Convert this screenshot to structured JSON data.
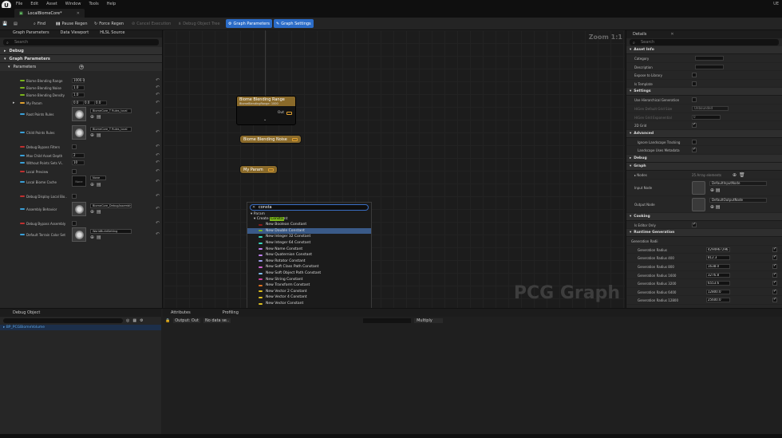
{
  "menu": {
    "items": [
      "File",
      "Edit",
      "Asset",
      "Window",
      "Tools",
      "Help"
    ],
    "right": "UE"
  },
  "tab": {
    "title": "LocalBiomeCore*"
  },
  "toolbar": {
    "find": "Find",
    "pause_regen": "Pause Regen",
    "force_regen": "Force Regen",
    "cancel_execution": "Cancel Execution",
    "debug_object_tree": "Debug Object Tree",
    "graph_parameters": "Graph Parameters",
    "graph_settings": "Graph Settings"
  },
  "left_panel": {
    "tabs": [
      "Graph Parameters",
      "Data Viewport",
      "HLSL Source"
    ],
    "search_placeholder": "Search",
    "sections": {
      "debug": "Debug",
      "graph_parameters": "Graph Parameters",
      "parameters": "Parameters"
    },
    "rows": [
      {
        "label": "Biome Blending Range",
        "value": "1000.0",
        "color": "#7ab51d"
      },
      {
        "label": "Biome Blending Noise",
        "value": "1.0",
        "color": "#7ab51d"
      },
      {
        "label": "Biome Blending Density",
        "value": "1.0",
        "color": "#7ab51d"
      },
      {
        "label": "My Param",
        "value": "0.0",
        "color": "#e0a030"
      },
      {
        "label": "Root Points Rules",
        "asset": "BiomeCore_T Rules_local",
        "color": "#3aa0d8"
      },
      {
        "label": "Child Points Rules",
        "asset": "BiomeCore_T Rules_local",
        "color": "#3aa0d8"
      },
      {
        "label": "Debug Bypass Filters",
        "color": "#c03030"
      },
      {
        "label": "Max Child Asset Depth",
        "value": "2",
        "color": "#3aa0d8"
      },
      {
        "label": "Without Points Sets Vi..",
        "value": "10",
        "color": "#3aa0d8"
      },
      {
        "label": "Local Preview",
        "color": "#c03030"
      },
      {
        "label": "Local Biome Cache",
        "asset": "None",
        "color": "#3aa0d8"
      },
      {
        "label": "Debug Display Local Bio..",
        "color": "#c03030"
      },
      {
        "label": "Assembly Behavior",
        "asset": "BiomeCore_DebugAssemblyBehavior",
        "color": "#3aa0d8"
      },
      {
        "label": "Debug Bypass Assembly",
        "color": "#c03030"
      },
      {
        "label": "Default Terrain Color Set",
        "asset": "WorldBuildSetting",
        "color": "#3aa0d8"
      }
    ]
  },
  "graph": {
    "zoom": "Zoom 1:1",
    "watermark": "PCG Graph",
    "node1": {
      "title": "Biome Blending Range",
      "subtitle": "BiomeBlendingRange: 1000",
      "out": "Out"
    },
    "node2": {
      "title": "Biome Blending Noise"
    },
    "node3": {
      "title": "My Param"
    }
  },
  "context_menu": {
    "search_value": "consta",
    "category": "Param",
    "subcategory_prefix": "Create ",
    "subcategory_highlight": "Consta",
    "subcategory_suffix": "nt",
    "items": [
      {
        "label": "New Boolean Constant",
        "color": "#8b1a1a"
      },
      {
        "label": "New Double Constant",
        "color": "#7ab51d"
      },
      {
        "label": "New Integer 32 Constant",
        "color": "#3ad8c0"
      },
      {
        "label": "New Integer 64 Constant",
        "color": "#3ad8c0"
      },
      {
        "label": "New Name Constant",
        "color": "#c080f0"
      },
      {
        "label": "New Quaternion Constant",
        "color": "#c080f0"
      },
      {
        "label": "New Rotator Constant",
        "color": "#a0a0f0"
      },
      {
        "label": "New Soft Class Path Constant",
        "color": "#d060d0"
      },
      {
        "label": "New Soft Object Path Constant",
        "color": "#80c0f0"
      },
      {
        "label": "New String Constant",
        "color": "#d040a0"
      },
      {
        "label": "New Transform Constant",
        "color": "#e07020"
      },
      {
        "label": "New Vector 2 Constant",
        "color": "#e0c020"
      },
      {
        "label": "New Vector 4 Constant",
        "color": "#e0c020"
      },
      {
        "label": "New Vector Constant",
        "color": "#e0c020"
      }
    ]
  },
  "details": {
    "tab": "Details",
    "search_placeholder": "Search",
    "sections": {
      "asset_info": "Asset Info",
      "settings": "Settings",
      "advanced": "Advanced",
      "debug": "Debug",
      "graph": "Graph",
      "cooking": "Cooking",
      "runtime_generation": "Runtime Generation"
    },
    "asset_info_rows": [
      "Category",
      "Description",
      "Expose to Library",
      "Is Template"
    ],
    "settings_rows": {
      "use_hierarchical": "Use Hierarchical Generation",
      "default_grid": "HiGen Default Grid Size",
      "default_grid_value": "Unbounded",
      "grid_exponential": "HiGen Grid Exponential",
      "grid_exponential_value": "0",
      "is_2d": "2D Grid"
    },
    "advanced_rows": [
      "Ignore Landscape Tracking",
      "Landscape Uses Metadata"
    ],
    "graph_rows": {
      "nodes": "Nodes",
      "nodes_value": "25 Array elements",
      "input_node": "Input Node",
      "input_node_value": "DefaultInputNode",
      "output_node": "Output Node",
      "output_node_value": "DefaultOutputNode"
    },
    "cooking_row": "Is Editor Only",
    "runtime_rows": [
      {
        "label": "Generation Radii",
        "value": ""
      },
      {
        "label": "Generation Radius",
        "value": "4294967296.0"
      },
      {
        "label": "Generation Radius 400",
        "value": "812.3"
      },
      {
        "label": "Generation Radius 800",
        "value": "1638.0"
      },
      {
        "label": "Generation Radius 1600",
        "value": "3276.8"
      },
      {
        "label": "Generation Radius 3200",
        "value": "6553.6"
      },
      {
        "label": "Generation Radius 6400",
        "value": "12800.0"
      },
      {
        "label": "Generation Radius 12800",
        "value": "25600.0"
      }
    ]
  },
  "bottom": {
    "debug_tab": "Debug Object",
    "tree_item": "BP_PCGBiomeVolume",
    "attributes_tab": "Attributes",
    "profiling_tab": "Profiling",
    "output_label": "Output: Out",
    "no_data": "No data se..",
    "multiply": "Multiply"
  }
}
